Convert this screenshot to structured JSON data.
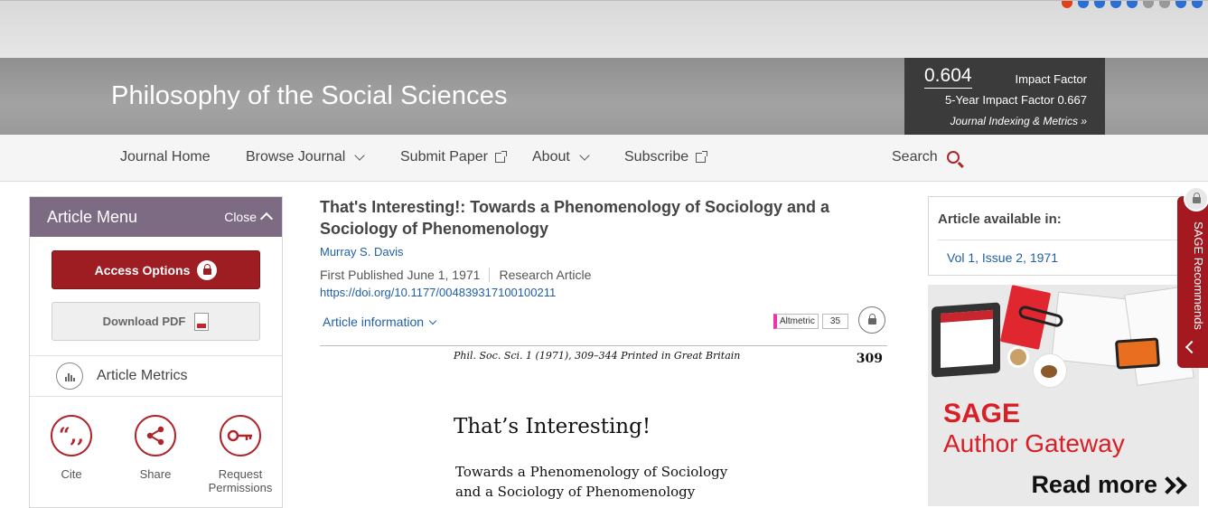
{
  "journal": {
    "title": "Philosophy of the Social Sciences"
  },
  "impact": {
    "value": "0.604",
    "label": "Impact Factor",
    "five_year": "5-Year Impact Factor 0.667",
    "indexing_link": "Journal Indexing & Metrics »"
  },
  "nav": {
    "items": [
      {
        "label": "Journal Home"
      },
      {
        "label": "Browse Journal"
      },
      {
        "label": "Submit Paper"
      },
      {
        "label": "About"
      },
      {
        "label": "Subscribe"
      }
    ],
    "search_label": "Search"
  },
  "article_menu": {
    "title": "Article Menu",
    "close_label": "Close",
    "access_label": "Access Options",
    "pdf_label": "Download PDF",
    "metrics_label": "Article Metrics",
    "tools": [
      {
        "label": "Cite",
        "glyph": "“,,"
      },
      {
        "label": "Share",
        "glyph": "share-icon"
      },
      {
        "label": "Request Permissions",
        "glyph": "key-icon"
      }
    ]
  },
  "article": {
    "title": "That's Interesting!: Towards a Phenomenology of Sociology and a Sociology of Phenomenology",
    "author": "Murray S. Davis",
    "published": "First Published June 1, 1971",
    "type": "Research Article",
    "doi": "https://doi.org/10.1177/004839317100100211",
    "info_label": "Article information",
    "altmetric_label": "Altmetric",
    "altmetric_score": "35"
  },
  "pdf_preview": {
    "header": "Phil. Soc. Sci. 1 (1971), 309–344   Printed in Great Britain",
    "page": "309",
    "title": "That’s  Interesting!",
    "sub1": "Towards a Phenomenology of Sociology",
    "sub2": "and a Sociology of Phenomenology"
  },
  "available": {
    "title": "Article available in:",
    "issue": "Vol 1, Issue 2, 1971"
  },
  "ad": {
    "brand": "SAGE",
    "tagline": "Author Gateway",
    "cta": "Read more"
  },
  "recommends": {
    "label": "SAGE Recommends"
  },
  "colors": {
    "accent_red": "#9e1d22",
    "menu_purple": "#7c6b82",
    "link_blue": "#1f5fa8",
    "impact_box": "#3b3b3b"
  }
}
